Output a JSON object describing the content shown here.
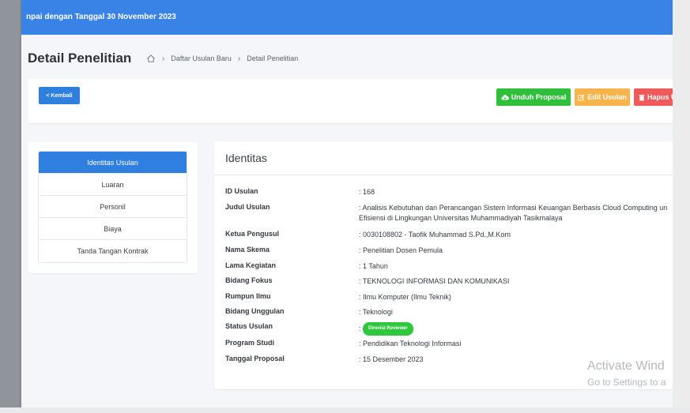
{
  "topbar": {
    "text": "npai dengan Tanggal 30 November 2023"
  },
  "header": {
    "title": "Detail Penelitian",
    "breadcrumb": [
      "Daftar Usulan Baru",
      "Detail Penelitian"
    ]
  },
  "toolbar": {
    "back_label": "< Kembali",
    "download_label": "Unduh Proposal",
    "edit_label": "Edit Usulan",
    "delete_label": "Hapus U"
  },
  "sidebar": {
    "items": [
      {
        "label": "Identitas Usulan",
        "active": true
      },
      {
        "label": "Luaran"
      },
      {
        "label": "Personil"
      },
      {
        "label": "Biaya"
      },
      {
        "label": "Tanda Tangan Kontrak"
      }
    ]
  },
  "main": {
    "title": "Identitas",
    "rows": [
      {
        "label": "ID Usulan",
        "value": ": 168"
      },
      {
        "label": "Judul Usulan",
        "value": ": Analisis Kebutuhan dan Perancangan Sistem Informasi Keuangan Berbasis Cloud Computing un",
        "value2": "Efisiensi di Lingkungan Universitas Muhammadiyah Tasikmalaya"
      },
      {
        "label": "Ketua Pengusul",
        "value": ": 0030108802 - Taofik Muhammad S.Pd.,M.Kom"
      },
      {
        "label": "Nama Skema",
        "value": ": Penelitian Dosen Pemula"
      },
      {
        "label": "Lama Kegiatan",
        "value": ": 1 Tahun"
      },
      {
        "label": "Bidang Fokus",
        "value": ": TEKNOLOGI INFORMASI DAN KOMUNIKASI"
      },
      {
        "label": "Rumpun Ilmu",
        "value": ": Ilmu Komputer (Ilmu Teknik)"
      },
      {
        "label": "Bidang Unggulan",
        "value": ": Teknologi"
      },
      {
        "label": "Status Usulan",
        "value": ":",
        "badge": "Direvisi Reviewer"
      },
      {
        "label": "Program Studi",
        "value": ": Pendidikan Teknologi Informasi"
      },
      {
        "label": "Tanggal Proposal",
        "value": ": 15 Desember 2023"
      }
    ]
  },
  "watermark": {
    "line1": "Activate Wind",
    "line2": "Go to Settings to a"
  },
  "colors": {
    "primary": "#2f7fe0",
    "success": "#2fbf3a",
    "warning": "#f6b44b",
    "danger": "#ef5a5a"
  }
}
